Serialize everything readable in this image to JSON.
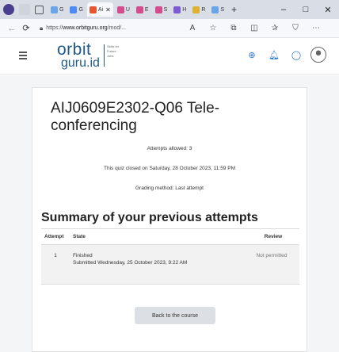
{
  "browser": {
    "tabs": [
      {
        "label": "G",
        "color": "#6aa5e8"
      },
      {
        "label": "G",
        "color": "#4c8bf5"
      },
      {
        "label": "Ai",
        "color": "#e8542d",
        "active": true
      },
      {
        "label": "U",
        "color": "#d64b8c"
      },
      {
        "label": "E",
        "color": "#d64b8c"
      },
      {
        "label": "S",
        "color": "#d64b8c"
      },
      {
        "label": "H",
        "color": "#7b5bd6"
      },
      {
        "label": "R",
        "color": "#e0b030"
      },
      {
        "label": "S",
        "color": "#6aa5e8"
      }
    ],
    "url_prefix": "https://",
    "url_host": "www.orbitguru.org",
    "url_path": "/mod/...",
    "win_minimize": "–",
    "win_maximize": "□",
    "win_close": "✕"
  },
  "header": {
    "logo_top": "orbit",
    "logo_bottom": "guru.id",
    "tagline": "Skills for Future Jobs"
  },
  "quiz": {
    "title": "AIJ0609E2302-Q06 Tele-conferencing",
    "attempts_allowed": "Attempts allowed: 3",
    "closed_on": "This quiz closed on Saturday, 28 October 2023, 11:59 PM",
    "grading_method": "Grading method: Last attempt"
  },
  "summary": {
    "title": "Summary of your previous attempts",
    "columns": {
      "attempt": "Attempt",
      "state": "State",
      "review": "Review"
    },
    "rows": [
      {
        "attempt": "1",
        "state": "Finished",
        "submitted": "Submitted Wednesday, 25 October 2023, 9:22 AM",
        "review": "Not permitted"
      }
    ]
  },
  "actions": {
    "back_label": "Back to the course"
  }
}
